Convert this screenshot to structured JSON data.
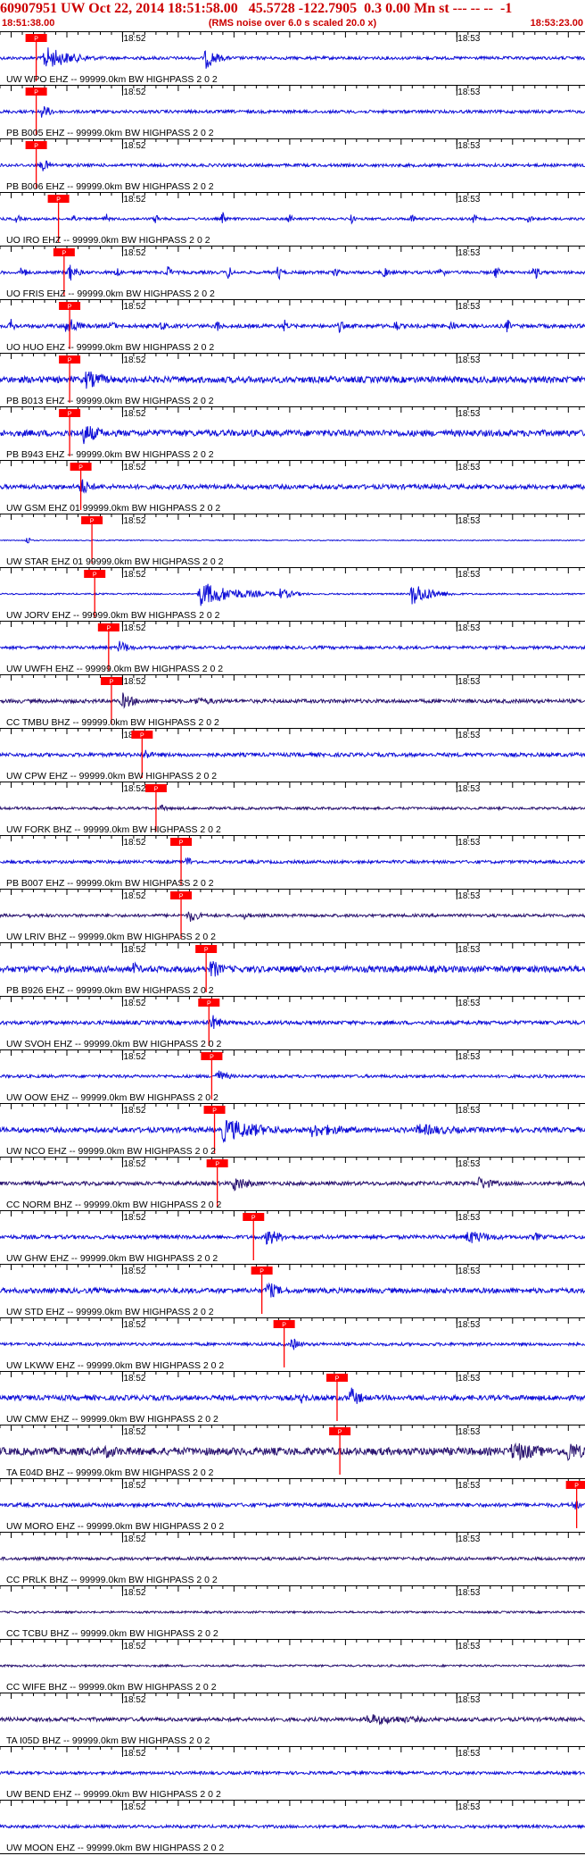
{
  "header": {
    "title": "60907951 UW Oct 22, 2014 18:51:58.00   45.5728 -122.7905  0.3 0.00 Mn st --- -- --  -1",
    "start_time": "18:51:38.00",
    "note": "(RMS noise over 6.0 s scaled 20.0 x)",
    "end_time": "18:53:23.00"
  },
  "chart_data": {
    "type": "line",
    "title": "60907951 UW Oct 22, 2014 18:51:58.00   45.5728 -122.7905  0.3 0.00 Mn st --- -- --  -1",
    "subtitle": "(RMS noise over 6.0 s scaled 20.0 x)",
    "x_range": [
      "18:51:38.00",
      "18:53:23.00"
    ],
    "x_range_seconds": [
      0,
      105
    ],
    "minute_labels": [
      {
        "t": 22,
        "label": "18:52"
      },
      {
        "t": 82,
        "label": "18:53"
      }
    ],
    "pick_label": "P",
    "colors": {
      "header": "#cc0000",
      "trace_blue": "#1010d8",
      "trace_dark": "#2a1470",
      "pick": "#ff0000",
      "grid": "#000000",
      "label": "#000000"
    },
    "series": [
      {
        "name": "UW WPO EHZ -- 99999.0km BW  HIGHPASS  2  0  2",
        "pick_s": 6.5,
        "color": "blue",
        "noise": 0.12,
        "bursts": [
          [
            8,
            5,
            1.0
          ],
          [
            37,
            2.2,
            0.9
          ]
        ]
      },
      {
        "name": "PB B005 EHZ -- 99999.0km BW  HIGHPASS  2  0  2",
        "pick_s": 6.5,
        "color": "blue",
        "noise": 0.12,
        "bursts": [
          [
            7.5,
            2,
            0.6
          ]
        ]
      },
      {
        "name": "PB B006 EHZ -- 99999.0km BW  HIGHPASS  2  0  2",
        "pick_s": 6.5,
        "color": "blue",
        "noise": 0.12,
        "bursts": [
          [
            7.5,
            2,
            0.55
          ]
        ]
      },
      {
        "name": "UO IRO EHZ -- 99999.0km BW  HIGHPASS  2  0  2",
        "pick_s": 10.5,
        "color": "blue",
        "noise": 0.1,
        "bursts": [
          [
            3,
            0.6,
            0.5
          ],
          [
            13,
            0.6,
            0.6
          ],
          [
            19,
            0.6,
            0.5
          ],
          [
            28,
            0.6,
            0.5
          ],
          [
            40,
            0.6,
            0.6
          ],
          [
            52,
            0.6,
            0.5
          ],
          [
            63,
            0.6,
            0.5
          ],
          [
            74,
            0.6,
            0.5
          ],
          [
            85,
            0.6,
            0.5
          ],
          [
            95,
            0.6,
            0.5
          ]
        ]
      },
      {
        "name": "UO FRIS EHZ -- 99999.0km BW  HIGHPASS  2  0  2",
        "pick_s": 11.5,
        "color": "blue",
        "noise": 0.12,
        "bursts": [
          [
            4,
            0.8,
            0.7
          ],
          [
            12.5,
            1.5,
            0.8
          ],
          [
            21,
            0.8,
            0.6
          ],
          [
            30,
            0.8,
            0.7
          ],
          [
            41,
            0.8,
            0.6
          ],
          [
            50,
            0.8,
            0.7
          ],
          [
            60,
            0.8,
            0.7
          ],
          [
            69,
            0.8,
            0.6
          ],
          [
            79,
            0.8,
            0.7
          ],
          [
            89,
            0.8,
            0.6
          ],
          [
            96,
            0.8,
            0.7
          ]
        ]
      },
      {
        "name": "UO HUO EHZ -- 99999.0km BW  HIGHPASS  2  0  2",
        "pick_s": 12.5,
        "color": "blue",
        "noise": 0.15,
        "bursts": [
          [
            2,
            0.8,
            0.6
          ],
          [
            12,
            2,
            0.9
          ],
          [
            20,
            0.8,
            0.6
          ],
          [
            29,
            0.8,
            0.6
          ],
          [
            39,
            0.8,
            0.6
          ],
          [
            51,
            0.8,
            0.6
          ],
          [
            61,
            0.8,
            0.6
          ],
          [
            71,
            0.8,
            0.6
          ],
          [
            81,
            0.8,
            0.6
          ],
          [
            91,
            0.8,
            0.6
          ]
        ]
      },
      {
        "name": "PB B013 EHZ -- 99999.0km BW  HIGHPASS  2  0  2",
        "pick_s": 12.5,
        "color": "blue",
        "noise": 0.25,
        "bursts": [
          [
            15.5,
            4,
            0.8
          ]
        ]
      },
      {
        "name": "PB B943 EHZ -- 99999.0km BW  HIGHPASS  2  0  2",
        "pick_s": 12.5,
        "color": "blue",
        "noise": 0.25,
        "bursts": [
          [
            15,
            3.5,
            0.9
          ]
        ]
      },
      {
        "name": "UW GSM EHZ 01 99999.0km BW  HIGHPASS  2  0  2",
        "pick_s": 14.5,
        "color": "blue",
        "noise": 0.18,
        "bursts": [
          [
            14.5,
            2,
            0.8
          ]
        ]
      },
      {
        "name": "UW STAR EHZ 01 99999.0km BW  HIGHPASS  2  0  2",
        "pick_s": 16.5,
        "color": "blue",
        "noise": 0.04,
        "bursts": [
          [
            5,
            0.5,
            0.4
          ]
        ]
      },
      {
        "name": "UW JORV EHZ -- 99999.0km BW  HIGHPASS  2  0  2",
        "pick_s": 17.0,
        "color": "blue",
        "noise": 0.06,
        "bursts": [
          [
            36,
            7,
            1.0
          ],
          [
            50,
            3,
            0.5
          ],
          [
            74,
            3.5,
            1.0
          ]
        ]
      },
      {
        "name": "UW UWFH EHZ -- 99999.0km BW  HIGHPASS  2  0  2",
        "pick_s": 19.5,
        "color": "blue",
        "noise": 0.12,
        "bursts": [
          [
            21.5,
            2,
            0.6
          ]
        ]
      },
      {
        "name": "CC TMBU BHZ -- 99999.0km BW  HIGHPASS  2  0  2",
        "pick_s": 20.0,
        "color": "dark",
        "noise": 0.15,
        "bursts": [
          [
            22,
            2.5,
            0.7
          ],
          [
            35,
            6,
            0.35
          ]
        ]
      },
      {
        "name": "UW CPW EHZ -- 99999.0km BW  HIGHPASS  2  0  2",
        "pick_s": 25.5,
        "color": "blue",
        "noise": 0.15,
        "bursts": [
          [
            26,
            1.5,
            0.5
          ]
        ]
      },
      {
        "name": "UW FORK BHZ -- 99999.0km BW  HIGHPASS  2  0  2",
        "pick_s": 28.0,
        "color": "dark",
        "noise": 0.1,
        "bursts": [
          [
            29,
            1.5,
            0.3
          ]
        ]
      },
      {
        "name": "PB B007 EHZ -- 99999.0km BW  HIGHPASS  2  0  2",
        "pick_s": 32.5,
        "color": "blue",
        "noise": 0.12,
        "bursts": [
          [
            33.5,
            1.5,
            0.5
          ]
        ]
      },
      {
        "name": "UW LRIV BHZ -- 99999.0km BW  HIGHPASS  2  0  2",
        "pick_s": 32.5,
        "color": "dark",
        "noise": 0.12,
        "bursts": [
          [
            5,
            1.5,
            0.25
          ],
          [
            34,
            2,
            0.6
          ],
          [
            44,
            1,
            0.4
          ]
        ]
      },
      {
        "name": "PB B926 EHZ -- 99999.0km BW  HIGHPASS  2  0  2",
        "pick_s": 37.0,
        "color": "blue",
        "noise": 0.25,
        "bursts": [
          [
            24,
            1.5,
            0.6
          ],
          [
            38,
            2,
            0.9
          ]
        ]
      },
      {
        "name": "UW SVOH EHZ -- 99999.0km BW  HIGHPASS  2  0  2",
        "pick_s": 37.5,
        "color": "blue",
        "noise": 0.15,
        "bursts": [
          [
            38,
            2,
            0.7
          ],
          [
            68,
            3,
            0.2
          ]
        ]
      },
      {
        "name": "UW OOW EHZ -- 99999.0km BW  HIGHPASS  2  0  2",
        "pick_s": 38.0,
        "color": "blue",
        "noise": 0.12,
        "bursts": [
          [
            39,
            2,
            0.6
          ]
        ]
      },
      {
        "name": "UW NCO EHZ -- 99999.0km BW  HIGHPASS  2  0  2",
        "pick_s": 38.5,
        "color": "blue",
        "noise": 0.2,
        "bursts": [
          [
            40,
            8,
            1.0
          ],
          [
            56,
            8,
            0.6
          ],
          [
            75,
            10,
            0.5
          ]
        ]
      },
      {
        "name": "CC NORM BHZ -- 99999.0km BW  HIGHPASS  2  0  2",
        "pick_s": 39.0,
        "color": "dark",
        "noise": 0.15,
        "bursts": [
          [
            42,
            3,
            0.7
          ],
          [
            86,
            3,
            0.6
          ]
        ]
      },
      {
        "name": "UW GHW EHZ -- 99999.0km BW  HIGHPASS  2  0  2",
        "pick_s": 45.5,
        "color": "blue",
        "noise": 0.15,
        "bursts": [
          [
            48,
            2.5,
            0.8
          ],
          [
            84,
            5,
            0.6
          ],
          [
            96,
            2,
            0.4
          ]
        ]
      },
      {
        "name": "UW STD EHZ -- 99999.0km BW  HIGHPASS  2  0  2",
        "pick_s": 47.0,
        "color": "blue",
        "noise": 0.2,
        "bursts": [
          [
            48,
            2.5,
            0.8
          ]
        ]
      },
      {
        "name": "UW LKWW EHZ -- 99999.0km BW  HIGHPASS  2  0  2",
        "pick_s": 51.0,
        "color": "blue",
        "noise": 0.12,
        "bursts": [
          [
            52.5,
            1.5,
            0.6
          ]
        ]
      },
      {
        "name": "UW CMW EHZ -- 99999.0km BW  HIGHPASS  2  0  2",
        "pick_s": 60.5,
        "color": "blue",
        "noise": 0.2,
        "bursts": [
          [
            54,
            2,
            0.5
          ],
          [
            63,
            2,
            0.9
          ]
        ]
      },
      {
        "name": "TA E04D BHZ -- 99999.0km BW  HIGHPASS  2  0  2",
        "pick_s": 61.0,
        "color": "dark",
        "noise": 0.3,
        "bursts": [
          [
            19,
            4,
            0.6
          ],
          [
            92,
            6,
            0.9
          ],
          [
            102,
            3,
            1.0
          ]
        ]
      },
      {
        "name": "UW MORO EHZ -- 99999.0km BW  HIGHPASS  2  0  2",
        "pick_s": 103.5,
        "color": "blue",
        "noise": 0.15,
        "bursts": [
          [
            103,
            1.5,
            0.5
          ]
        ]
      },
      {
        "name": "CC PRLK BHZ -- 99999.0km BW  HIGHPASS  2  0  2",
        "pick_s": null,
        "color": "dark",
        "noise": 0.12,
        "bursts": []
      },
      {
        "name": "CC TCBU BHZ -- 99999.0km BW  HIGHPASS  2  0  2",
        "pick_s": null,
        "color": "dark",
        "noise": 0.08,
        "bursts": []
      },
      {
        "name": "CC WIFE BHZ -- 99999.0km BW  HIGHPASS  2  0  2",
        "pick_s": null,
        "color": "dark",
        "noise": 0.08,
        "bursts": []
      },
      {
        "name": "TA I05D BHZ -- 99999.0km BW  HIGHPASS  2  0  2",
        "pick_s": null,
        "color": "dark",
        "noise": 0.15,
        "bursts": [
          [
            66,
            12,
            0.45
          ]
        ]
      },
      {
        "name": "UW BEND EHZ -- 99999.0km BW  HIGHPASS  2  0  2",
        "pick_s": null,
        "color": "blue",
        "noise": 0.12,
        "bursts": []
      },
      {
        "name": "UW MOON EHZ -- 99999.0km BW  HIGHPASS  2  0  2",
        "pick_s": null,
        "color": "blue",
        "noise": 0.12,
        "bursts": []
      }
    ]
  }
}
